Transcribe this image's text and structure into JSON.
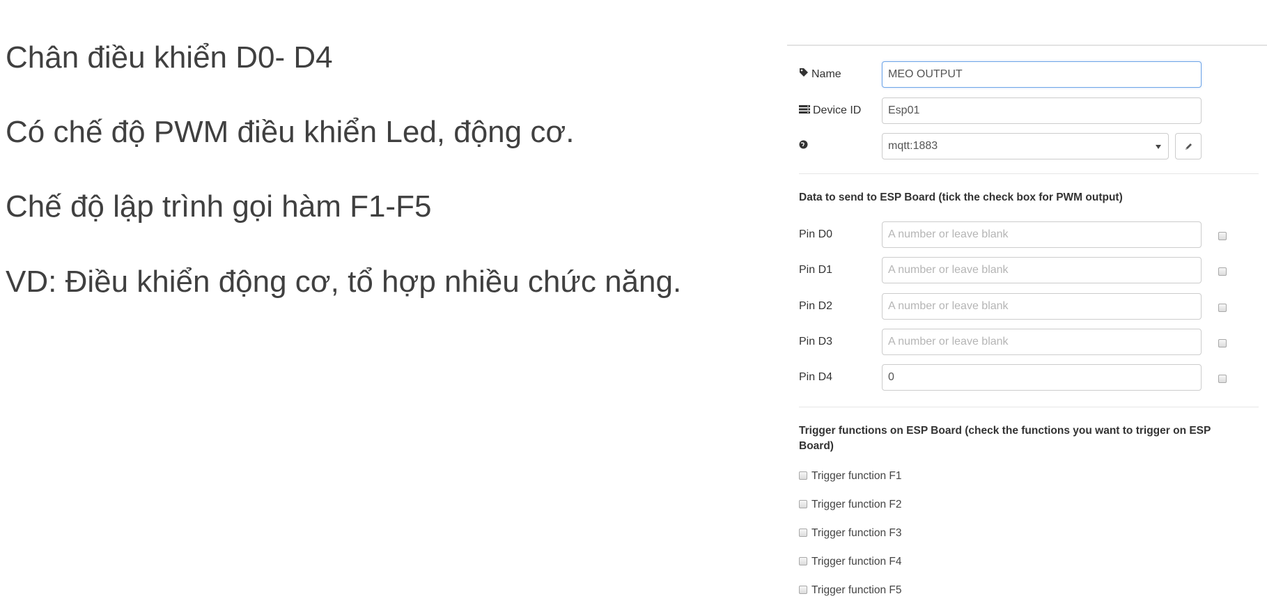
{
  "notes": [
    "Chân điều khiển D0- D4",
    "Có chế độ PWM điều khiển Led, động cơ.",
    "Chế độ lập trình gọi hàm F1-F5",
    "VD: Điều khiển động cơ, tổ hợp nhiều chức năng."
  ],
  "form": {
    "name_label": "Name",
    "name_value": "MEO OUTPUT",
    "device_label": "Device ID",
    "device_value": "Esp01",
    "broker_value": "mqtt:1883",
    "data_heading": "Data to send to ESP Board (tick the check box for PWM output)",
    "pin_placeholder": "A number or leave blank",
    "pins": [
      {
        "label": "Pin D0",
        "value": ""
      },
      {
        "label": "Pin D1",
        "value": ""
      },
      {
        "label": "Pin D2",
        "value": ""
      },
      {
        "label": "Pin D3",
        "value": ""
      },
      {
        "label": "Pin D4",
        "value": "0"
      }
    ],
    "trigger_heading": "Trigger functions on ESP Board (check the functions you want to trigger on ESP Board)",
    "triggers": [
      "Trigger function F1",
      "Trigger function F2",
      "Trigger function F3",
      "Trigger function F4",
      "Trigger function F5"
    ]
  },
  "icons": {
    "name": "tag-icon",
    "device": "server-icon",
    "broker": "globe-icon",
    "edit": "pencil-icon"
  },
  "colors": {
    "focus_border": "#6fa6e8",
    "text": "#333333"
  }
}
